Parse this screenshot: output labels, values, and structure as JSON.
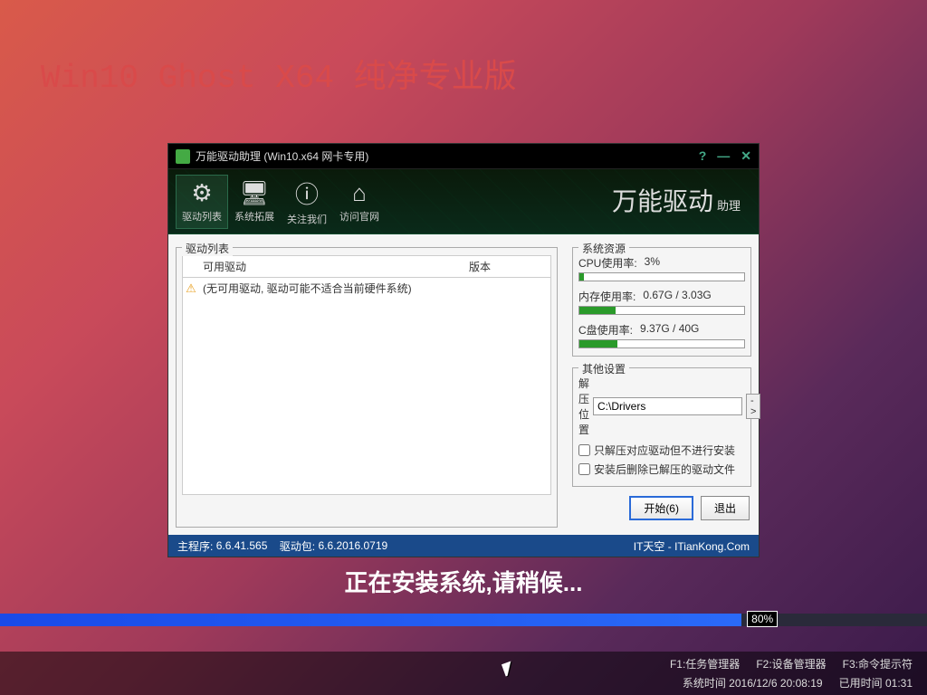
{
  "page_title": "Win10 Ghost X64 纯净专业版",
  "window": {
    "title": "万能驱动助理 (Win10.x64 网卡专用)",
    "toolbar": [
      {
        "icon": "⚙",
        "label": "驱动列表",
        "active": true
      },
      {
        "icon": "🖥",
        "label": "系统拓展",
        "active": false
      },
      {
        "icon": "ⓘ",
        "label": "关注我们",
        "active": false
      },
      {
        "icon": "⌂",
        "label": "访问官网",
        "active": false
      }
    ],
    "brand": "万能驱动",
    "brand_sub": "助理"
  },
  "driver_list": {
    "title": "驱动列表",
    "columns": {
      "c1": "",
      "c2": "可用驱动",
      "c3": "版本"
    },
    "row_msg": "(无可用驱动, 驱动可能不适合当前硬件系统)"
  },
  "resources": {
    "title": "系统资源",
    "cpu": {
      "label": "CPU使用率:",
      "value": "3%",
      "pct": 3
    },
    "mem": {
      "label": "内存使用率:",
      "value": "0.67G / 3.03G",
      "pct": 22
    },
    "disk": {
      "label": "C盘使用率:",
      "value": "9.37G / 40G",
      "pct": 23
    }
  },
  "settings": {
    "title": "其他设置",
    "extract_label": "解压位置",
    "extract_path": "C:\\Drivers",
    "browse": "->",
    "cb1": "只解压对应驱动但不进行安装",
    "cb2": "安装后删除已解压的驱动文件"
  },
  "actions": {
    "start": "开始(6)",
    "exit": "退出"
  },
  "statusbar": {
    "main_ver_label": "主程序:",
    "main_ver": "6.6.41.565",
    "pack_label": "驱动包:",
    "pack_ver": "6.6.2016.0719",
    "credit": "IT天空 - ITianKong.Com"
  },
  "install_msg": "正在安装系统,请稍候...",
  "install_pct": "80%",
  "bottom": {
    "f1": "F1:任务管理器",
    "f2": "F2:设备管理器",
    "f3": "F3:命令提示符",
    "time_label": "系统时间",
    "time": "2016/12/6 20:08:19",
    "elapsed_label": "已用时间",
    "elapsed": "01:31"
  }
}
